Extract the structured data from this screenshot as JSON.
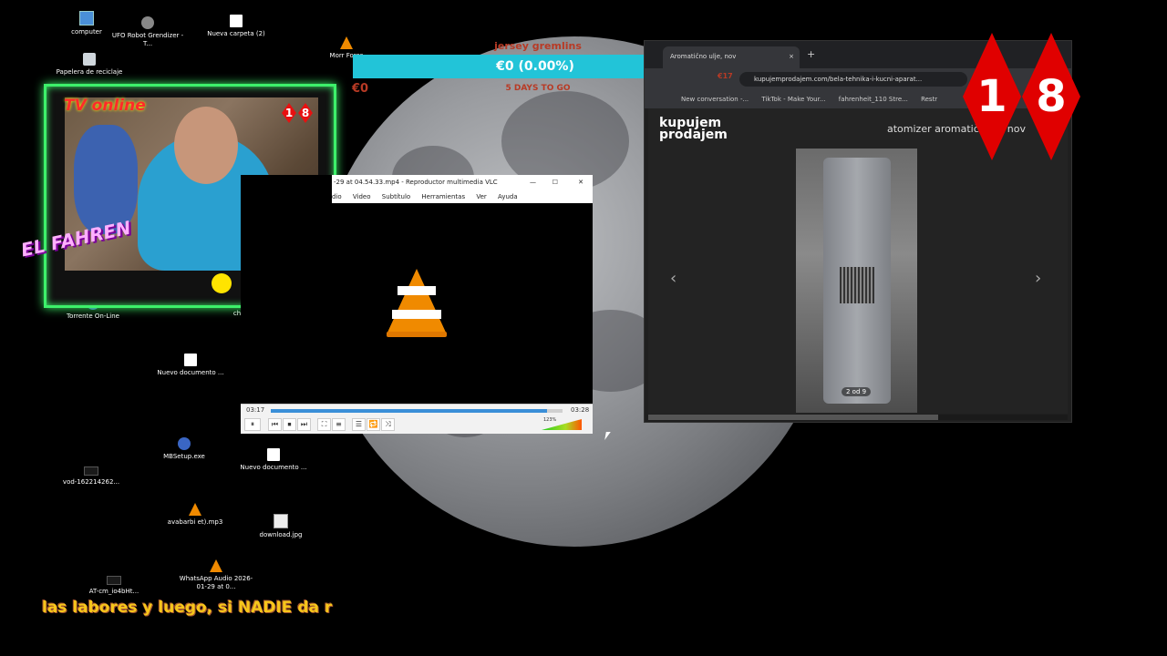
{
  "desktop_icons": [
    {
      "label": "computer",
      "kind": "pc"
    },
    {
      "label": "UFO Robot Grendizer - T...",
      "kind": "ufo"
    },
    {
      "label": "Nueva carpeta (2)",
      "kind": "file"
    },
    {
      "label": "Papelera de reciclaje",
      "kind": "bin"
    },
    {
      "label": "Torrente On-Line",
      "kind": "exe"
    },
    {
      "label": "Nuevo documento ...",
      "kind": "file"
    },
    {
      "label": "MBSetup.exe",
      "kind": "exe"
    },
    {
      "label": "vod-162214262...",
      "kind": "vid"
    },
    {
      "label": "Nuevo documento ...",
      "kind": "file"
    },
    {
      "label": "avabarbi et).mp3",
      "kind": "cone"
    },
    {
      "label": "download.jpg",
      "kind": "img"
    },
    {
      "label": "AT-cm_io4bHt...",
      "kind": "vid"
    },
    {
      "label": "WhatsApp Audio 2026-01-29 at 0...",
      "kind": "cone"
    },
    {
      "label": "Morr Fores",
      "kind": "cone"
    },
    {
      "label": "ch",
      "kind": "none"
    }
  ],
  "donation": {
    "title": "jersey gremlins",
    "amount_bar": "€0 (0.00%)",
    "raised": "€0",
    "days_left": "5 DAYS TO GO",
    "bar_color": "#22c4d8",
    "text_color": "#b83a25",
    "progress": 0.0
  },
  "webcam": {
    "overlay_text": "TV online",
    "badge": [
      "1",
      "8"
    ],
    "logo_text": "EL FAHREN",
    "frame_color": "#3df06a"
  },
  "vlc": {
    "title": "-29 at 04.54.33.mp4 - Reproductor multimedia VLC",
    "menu": [
      "dio",
      "Video",
      "Subtítulo",
      "Herramientas",
      "Ver",
      "Ayuda"
    ],
    "time_elapsed": "03:17",
    "time_total": "03:28",
    "progress": 0.947,
    "volume": "123%",
    "window_controls": [
      "—",
      "☐",
      "✕"
    ],
    "buttons": [
      "⏸",
      "⏮",
      "⏹",
      "⏭",
      "⛶",
      "≡",
      "☰",
      "🔁",
      "⤨"
    ]
  },
  "browser": {
    "tab_title": "Aromatično ulje, nov",
    "tab_close": "×",
    "new_tab": "+",
    "url": "kupujemprodajem.com/bela-tehnika-i-kucni-aparat...",
    "price_ghost": "€17",
    "bookmarks": [
      "New conversation -...",
      "TikTok - Make Your...",
      "fahrenheit_110 Stre...",
      "Restr"
    ],
    "site_logo": "kupujem prodajem",
    "listing_title": "atomizer aromatični ..., nov",
    "image_counter": "2 od 9",
    "prev_arrow": "‹",
    "next_arrow": "›"
  },
  "age_badge": [
    "1",
    "8"
  ],
  "age_badge_color": "#e00000",
  "ticker": "las labores y luego, si NADIE da r"
}
